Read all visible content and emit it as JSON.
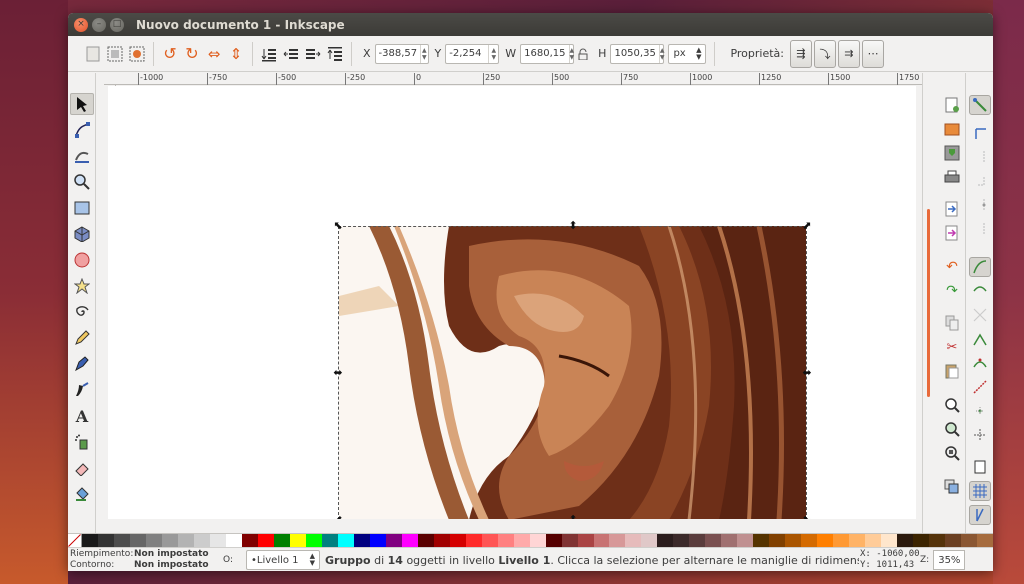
{
  "window": {
    "title": "Nuovo documento 1 - Inkscape",
    "controls": {
      "close": "×",
      "minimize": "–",
      "maximize": "□"
    }
  },
  "toolbar": {
    "x_label": "X",
    "x_value": "-388,57",
    "y_label": "Y",
    "y_value": "-2,254",
    "w_label": "W",
    "w_value": "1680,15",
    "h_label": "H",
    "h_value": "1050,35",
    "unit": "px",
    "properties_label": "Proprietà:"
  },
  "ruler": {
    "labels": [
      "-1000",
      "-750",
      "-500",
      "-250",
      "0",
      "250",
      "500",
      "750",
      "1000",
      "1250",
      "1500",
      "1750"
    ]
  },
  "status": {
    "fill_label": "Riempimento:",
    "fill_value": "Non impostato",
    "stroke_label": "Contorno:",
    "stroke_value": "Non impostato",
    "opacity_label": "O:",
    "layer": "•Livello 1",
    "msg_group": "Gruppo",
    "msg_of": "di",
    "msg_count": "14",
    "msg_objects": "oggetti in livello",
    "msg_layer": "Livello 1",
    "msg_tail": ". Clicca la selezione per alternare le maniglie di ridimensiona...",
    "x_coord": "X: -1060,00",
    "y_coord": "Y: 1011,43",
    "zoom_label": "Z:",
    "zoom_value": "35%"
  },
  "palette": [
    "#1a1a1a",
    "#333333",
    "#4d4d4d",
    "#666666",
    "#808080",
    "#999999",
    "#b3b3b3",
    "#cccccc",
    "#e6e6e6",
    "#ffffff",
    "#800000",
    "#ff0000",
    "#008000",
    "#ffff00",
    "#00ff00",
    "#008080",
    "#00ffff",
    "#000080",
    "#0000ff",
    "#800080",
    "#ff00ff",
    "#5a0000",
    "#a00000",
    "#d40000",
    "#ff2a2a",
    "#ff5555",
    "#ff8080",
    "#ffaaaa",
    "#ffd5d5",
    "#550000",
    "#803333",
    "#aa4444",
    "#c87373",
    "#d79898",
    "#e6bbbb",
    "#e0c8c8",
    "#2b1d1d",
    "#3c2a2a",
    "#5a3c3c",
    "#7a5050",
    "#a07070",
    "#c09090",
    "#553300",
    "#804000",
    "#aa5500",
    "#d46a00",
    "#ff7f00",
    "#ff9933",
    "#ffb366",
    "#ffcc99",
    "#ffe6cc",
    "#2b1a0d",
    "#3c2400",
    "#55330a",
    "#6b4022",
    "#8a5733",
    "#a66c3e"
  ]
}
